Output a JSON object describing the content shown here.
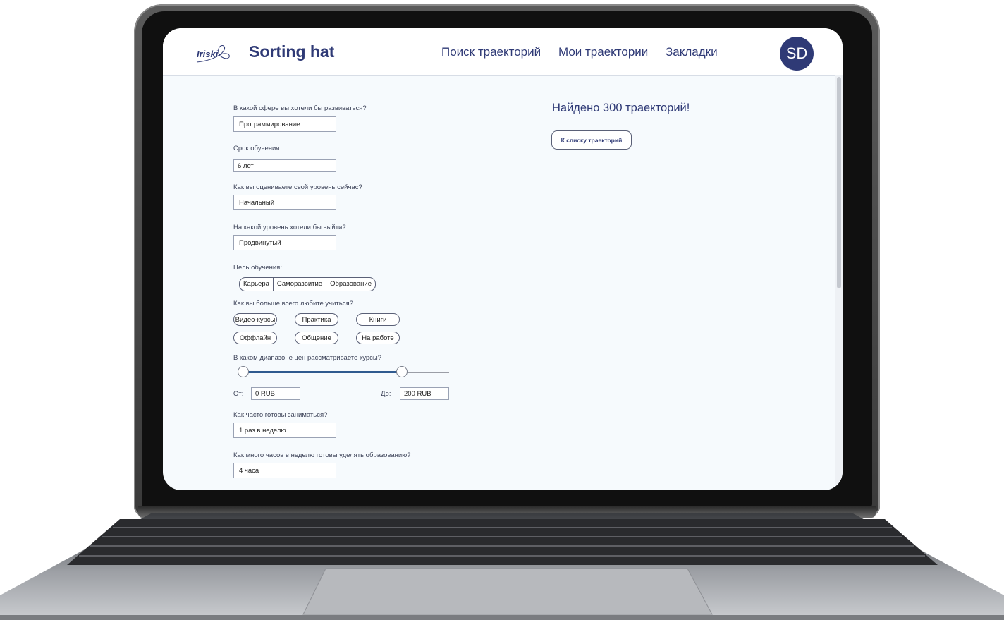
{
  "header": {
    "logo_text": "Iriski",
    "brand": "Sorting hat",
    "nav": [
      "Поиск траекторий",
      "Мои траектории",
      "Закладки"
    ],
    "avatar": "SD"
  },
  "form": {
    "sphere": {
      "label": "В какой сфере вы хотели бы развиваться?",
      "value": "Программирование"
    },
    "duration": {
      "label": "Срок обучения:",
      "value": "6 лет"
    },
    "current_level": {
      "label": "Как вы оцениваете свой уровень сейчас?",
      "value": "Начальный"
    },
    "target_level": {
      "label": "На какой уровень хотели бы выйти?",
      "value": "Продвинутый"
    },
    "goal": {
      "label": "Цель обучения:",
      "options": [
        "Карьера",
        "Саморазвитие",
        "Образование"
      ]
    },
    "learning_style": {
      "label": "Как вы больше всего любите учиться?",
      "options": [
        "Видео-курсы",
        "Практика",
        "Книги",
        "Оффлайн",
        "Общение",
        "На работе"
      ]
    },
    "price": {
      "label": "В каком диапазоне цен рассматриваете курсы?",
      "from_label": "От:",
      "from_value": "0 RUB",
      "to_label": "До:",
      "to_value": "200 RUB",
      "range_fraction": [
        0.0,
        0.77
      ]
    },
    "frequency": {
      "label": "Как часто готовы заниматься?",
      "value": "1 раз в неделю"
    },
    "hours": {
      "label": "Как много часов в неделю готовы уделять образованию?",
      "value": "4 часа"
    }
  },
  "results": {
    "found": "Найдено 300 траекторий!",
    "list_button": "К списку траекторий"
  },
  "colors": {
    "accent": "#2f3a76",
    "slider": "#2f5a8f"
  }
}
